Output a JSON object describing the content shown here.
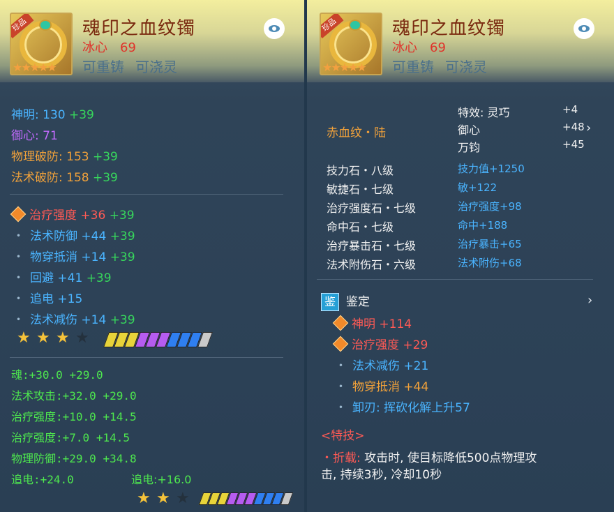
{
  "left": {
    "item_name": "魂印之血纹镯",
    "rarity_tag": "珍品",
    "sub_label": "冰心",
    "level": "69",
    "recast": "可重铸",
    "enchant": "可浇灵",
    "base_stats": [
      {
        "name": "神明:",
        "value": "130",
        "bonus": "+39",
        "color": "blue"
      },
      {
        "name": "御心:",
        "value": "71",
        "bonus": "",
        "color": "purple"
      },
      {
        "name": "物理破防:",
        "value": "153",
        "bonus": "+39",
        "color": "orange"
      },
      {
        "name": "法术破防:",
        "value": "158",
        "bonus": "+39",
        "color": "orange"
      }
    ],
    "attr_stats": [
      {
        "name": "治疗强度",
        "value": "+36",
        "bonus": "+39",
        "marker": "diamond",
        "color": "red"
      },
      {
        "name": "法术防御",
        "value": "+44",
        "bonus": "+39",
        "marker": "dot",
        "color": "blue"
      },
      {
        "name": "物穿抵消",
        "value": "+14",
        "bonus": "+39",
        "marker": "dot",
        "color": "blue"
      },
      {
        "name": "回避",
        "value": "+41",
        "bonus": "+39",
        "marker": "dot",
        "color": "blue"
      },
      {
        "name": "追电",
        "value": "+15",
        "bonus": "",
        "marker": "dot",
        "color": "blue"
      },
      {
        "name": "法术减伤",
        "value": "+14",
        "bonus": "+39",
        "marker": "dot",
        "color": "blue"
      }
    ],
    "stars_filled": 3,
    "stars_total": 4,
    "soul_stats": [
      {
        "name": "魂:",
        "value": "+30.0",
        "bonus": "+29.0"
      },
      {
        "name": "法术攻击:",
        "value": "+32.0",
        "bonus": "+29.0"
      },
      {
        "name": "治疗强度:",
        "value": "+10.0",
        "bonus": "+14.5"
      },
      {
        "name": "治疗强度:",
        "value": "+7.0",
        "bonus": "+14.5"
      },
      {
        "name": "物理防御:",
        "value": "+29.0",
        "bonus": "+34.8"
      },
      {
        "name": "追电:",
        "value": "+24.0",
        "bonus": ""
      }
    ],
    "extra_stat": "追电:+16.0",
    "bottom_stars_filled": 2,
    "bottom_stars_total": 3
  },
  "right": {
    "item_name": "魂印之血纹镯",
    "rarity_tag": "珍品",
    "sub_label": "冰心",
    "level": "69",
    "recast": "可重铸",
    "enchant": "可浇灵",
    "pattern": "赤血纹・陆",
    "effects": [
      {
        "name": "特效: 灵巧",
        "value": "+4"
      },
      {
        "name": "御心",
        "value": "+48"
      },
      {
        "name": "万钧",
        "value": "+45"
      }
    ],
    "stones": [
      {
        "name": "技力石・八级",
        "effect": "技力值+1250"
      },
      {
        "name": "敏捷石・七级",
        "effect": "敏+122"
      },
      {
        "name": "治疗强度石・七级",
        "effect": "治疗强度+98"
      },
      {
        "name": "命中石・七级",
        "effect": "命中+188"
      },
      {
        "name": "治疗暴击石・七级",
        "effect": "治疗暴击+65"
      },
      {
        "name": "法术附伤石・六级",
        "effect": "法术附伤+68"
      }
    ],
    "appraise_icon": "鉴",
    "appraise_label": "鉴定",
    "appraise_stats": [
      {
        "name": "神明",
        "value": "+114",
        "marker": "diamond",
        "color": "red"
      },
      {
        "name": "治疗强度",
        "value": "+29",
        "marker": "diamond",
        "color": "red"
      },
      {
        "name": "法术减伤",
        "value": "+21",
        "marker": "dot",
        "color": "blue"
      },
      {
        "name": "物穿抵消",
        "value": "+44",
        "marker": "dot",
        "color": "orange"
      },
      {
        "name": "卸刃: 挥砍化解上升57",
        "value": "",
        "marker": "dot",
        "color": "blue"
      }
    ],
    "skill_header": "<特技>",
    "skill_name": "・折载:",
    "skill_desc_1": "攻击时, 使目标降低500点物理攻",
    "skill_desc_2": "击, 持续3秒, 冷却10秒"
  },
  "gem_colors": [
    "#e8d43a",
    "#e8d43a",
    "#e8d43a",
    "#b65cf0",
    "#b65cf0",
    "#b65cf0",
    "#2f7ff0",
    "#2f7ff0",
    "#2f7ff0",
    "#c9c9c9"
  ]
}
